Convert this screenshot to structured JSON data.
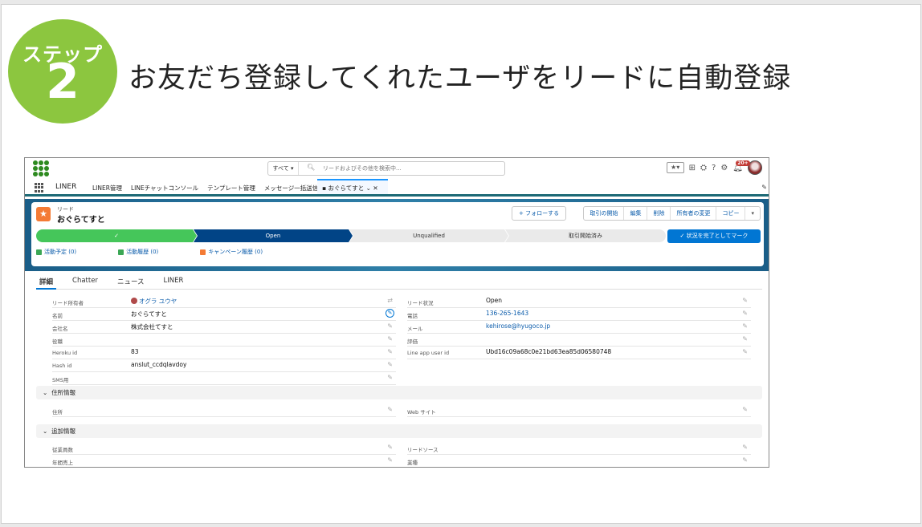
{
  "slide": {
    "badge_step": "ステップ",
    "badge_num": "2",
    "title": "お友だち登録してくれたユーザをリードに自動登録"
  },
  "topbar": {
    "search_scope": "すべて ▾",
    "search_placeholder": "リードおよびその他を検索中...",
    "notif_count": "20+"
  },
  "nav": {
    "app_name": "LINER",
    "items": [
      "LINER管理",
      "LINEチャットコンソール",
      "テンプレート管理",
      "メッセージ一括送信"
    ],
    "active_tab": "おぐらてすと"
  },
  "record": {
    "type": "リード",
    "name": "おぐらてすと",
    "follow": "+ フォローする",
    "actions": [
      "取引の開始",
      "編集",
      "削除",
      "所有者の変更",
      "コピー",
      "▾"
    ],
    "path": {
      "step1": "✓",
      "step2": "Open",
      "step3": "Unqualified",
      "step4": "取引開始済み"
    },
    "complete_button": "✓ 状況を完了としてマーク",
    "related": [
      "活動予定 (0)",
      "活動履歴 (0)",
      "キャンペーン履歴 (0)"
    ]
  },
  "tabs": [
    "詳細",
    "Chatter",
    "ニュース",
    "LINER"
  ],
  "details_left": [
    {
      "label": "リード所有者",
      "value": "オグラ ユウヤ"
    },
    {
      "label": "名前",
      "value": "おぐらてすと"
    },
    {
      "label": "会社名",
      "value": "株式会社てすと"
    },
    {
      "label": "役職",
      "value": ""
    },
    {
      "label": "Heroku id",
      "value": "83"
    },
    {
      "label": "Hash id",
      "value": "anslut_ccdqlavdoy"
    },
    {
      "label": "SMS用",
      "value": ""
    }
  ],
  "details_right": [
    {
      "label": "リード状況",
      "value": "Open"
    },
    {
      "label": "電話",
      "value": "136-265-1643"
    },
    {
      "label": "メール",
      "value": "kehirose@hyugoco.jp"
    },
    {
      "label": "評価",
      "value": ""
    },
    {
      "label": "Line app user id",
      "value": "Ubd16c09a68c0e21bd63ea85d06580748"
    }
  ],
  "section_address": {
    "title": "住所情報",
    "left_label": "住所",
    "right_label": "Web サイト"
  },
  "section_extra": {
    "title": "追加情報",
    "rows": [
      {
        "left": "従業員数",
        "right": "リードソース"
      },
      {
        "left": "年間売上",
        "right": "業種"
      }
    ]
  }
}
